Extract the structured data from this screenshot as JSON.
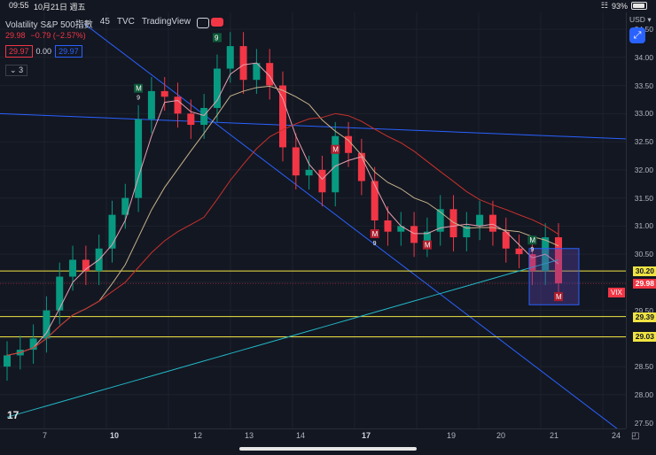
{
  "status": {
    "time": "09:55",
    "date": "10月21日 週五",
    "battery": "93%",
    "battery_level": 0.93
  },
  "legend": {
    "symbol": "Volatility S&P 500指數",
    "interval": "45",
    "exchange": "TVC",
    "brand": "TradingView",
    "last": "29.98",
    "change": "−0.79 (−2.57%)"
  },
  "indicator": {
    "value_a": "29.97",
    "value_b": "0.00",
    "value_c": "29.97",
    "collapse_label": "3"
  },
  "price_axis": {
    "currency": "USD",
    "ticks": [
      "34.50",
      "34.00",
      "33.50",
      "33.00",
      "32.50",
      "32.00",
      "31.50",
      "31.00",
      "30.50",
      "29.50",
      "28.50",
      "28.00",
      "27.50"
    ],
    "tags": {
      "line1": "30.20",
      "current": "29.98",
      "line2": "29.39",
      "line3": "29.03"
    },
    "symbol_tag": "VIX"
  },
  "time_axis": {
    "labels": [
      "7",
      "10",
      "12",
      "13",
      "14",
      "17",
      "19",
      "20",
      "21",
      "24"
    ],
    "bold": [
      "10",
      "17"
    ]
  },
  "chart_data": {
    "type": "candlestick",
    "ylim": [
      27.4,
      34.8
    ],
    "x": [
      "7",
      "10",
      "12",
      "13",
      "14",
      "17",
      "19",
      "20",
      "21",
      "24"
    ],
    "colors": {
      "up": "#089981",
      "down": "#f23645",
      "yellow_line": "#f0e442",
      "blue_line": "#2962ff",
      "cyan_ma": "#22b8c7",
      "red_ma": "#c8312b",
      "tan_ma": "#c7b28b",
      "pink_ma": "#e7a1b0"
    },
    "horizontal_levels": [
      30.2,
      29.39,
      29.03
    ],
    "close_series": [
      28.7,
      28.8,
      29.0,
      29.5,
      30.1,
      30.4,
      30.2,
      30.6,
      31.2,
      31.5,
      32.9,
      33.4,
      33.3,
      33.0,
      32.8,
      33.1,
      33.8,
      34.2,
      33.6,
      33.9,
      33.5,
      32.4,
      31.9,
      32.0,
      31.6,
      32.6,
      32.3,
      31.8,
      31.1,
      30.9,
      31.0,
      30.7,
      30.9,
      31.3,
      30.8,
      31.0,
      31.2,
      30.9,
      30.6,
      30.5,
      30.2,
      30.8,
      29.98
    ],
    "markers": [
      {
        "label": "M",
        "sublabel": "9",
        "kind": "buy"
      },
      {
        "label": "9",
        "kind": "buy"
      },
      {
        "label": "M",
        "kind": "sell"
      },
      {
        "label": "M",
        "sublabel": "9",
        "kind": "sell"
      },
      {
        "label": "M",
        "kind": "sell"
      },
      {
        "label": "M",
        "sublabel": "9",
        "kind": "buy"
      },
      {
        "label": "M",
        "kind": "sell"
      }
    ]
  }
}
